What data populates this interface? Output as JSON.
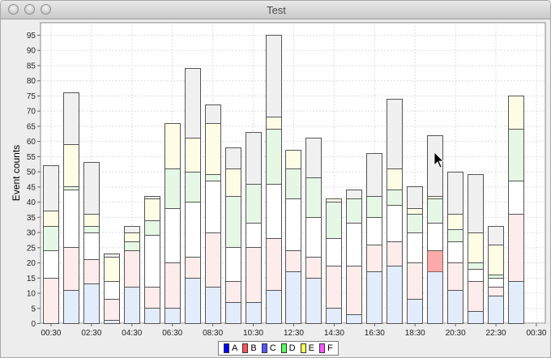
{
  "window": {
    "title": "Test"
  },
  "chart_data": {
    "type": "bar",
    "stacked": true,
    "title": "",
    "xlabel": "",
    "ylabel": "Event counts",
    "ylim": [
      0,
      99
    ],
    "yticks": [
      0,
      5,
      10,
      15,
      20,
      25,
      30,
      35,
      40,
      45,
      50,
      55,
      60,
      65,
      70,
      75,
      80,
      85,
      90,
      95
    ],
    "xlim": [
      0,
      24
    ],
    "xticks": [
      {
        "label": "00:30",
        "x": 0.5
      },
      {
        "label": "02:30",
        "x": 2.5
      },
      {
        "label": "04:30",
        "x": 4.5
      },
      {
        "label": "06:30",
        "x": 6.5
      },
      {
        "label": "08:30",
        "x": 8.5
      },
      {
        "label": "10:30",
        "x": 10.5
      },
      {
        "label": "12:30",
        "x": 12.5
      },
      {
        "label": "14:30",
        "x": 14.5
      },
      {
        "label": "16:30",
        "x": 16.5
      },
      {
        "label": "18:30",
        "x": 18.5
      },
      {
        "label": "20:30",
        "x": 20.5
      },
      {
        "label": "22:30",
        "x": 22.5
      },
      {
        "label": "00:30",
        "x": 24.5
      }
    ],
    "grid": true,
    "legend_position": "bottom-center",
    "x": [
      0.5,
      1.5,
      2.5,
      3.5,
      4.5,
      5.5,
      6.5,
      7.5,
      8.5,
      9.5,
      10.5,
      11.5,
      12.5,
      13.5,
      14.5,
      15.5,
      16.5,
      17.5,
      18.5,
      19.5,
      20.5,
      21.5,
      22.5,
      23.5
    ],
    "series": [
      {
        "name": "A",
        "color": "#0000ff",
        "fill": "#e2ecfb",
        "values": [
          0,
          11,
          13,
          1,
          12,
          5,
          5,
          15,
          12,
          7,
          7,
          11,
          17,
          15,
          5,
          3,
          17,
          19,
          8,
          17,
          11,
          4,
          9,
          14
        ]
      },
      {
        "name": "B",
        "color": "#ff5555",
        "fill": "#fcecec",
        "values": [
          15,
          14,
          8,
          7,
          12,
          7,
          15,
          7,
          18,
          7,
          18,
          17,
          7,
          7,
          14,
          16,
          9,
          8,
          12,
          7,
          9,
          10,
          3,
          22
        ]
      },
      {
        "name": "C",
        "color": "#5555ff",
        "fill": "#ffffff",
        "values": [
          9,
          19,
          9,
          6,
          0,
          17,
          18,
          18,
          17,
          11,
          8,
          18,
          17,
          13,
          9,
          14,
          9,
          12,
          10,
          9,
          7,
          4,
          3,
          11
        ]
      },
      {
        "name": "D",
        "color": "#55ff55",
        "fill": "#e6f7e6",
        "values": [
          8,
          1,
          2,
          0,
          3,
          5,
          13,
          10,
          2,
          17,
          13,
          18,
          10,
          13,
          12,
          8,
          7,
          5,
          6,
          8,
          4,
          2,
          1,
          17
        ]
      },
      {
        "name": "E",
        "color": "#ffff55",
        "fill": "#fdfde6",
        "values": [
          5,
          14,
          4,
          8,
          3,
          7,
          15,
          11,
          17,
          9,
          0,
          4,
          6,
          0,
          1,
          0,
          0,
          7,
          2,
          1,
          5,
          10,
          10,
          11
        ]
      },
      {
        "name": "F",
        "color": "#ff55ff",
        "fill": "#f0f0f0",
        "values": [
          15,
          17,
          17,
          1,
          2,
          1,
          0,
          23,
          6,
          7,
          17,
          27,
          0,
          13,
          0,
          3,
          14,
          23,
          7,
          20,
          14,
          19,
          6,
          0
        ]
      }
    ],
    "highlighted": {
      "series": "B",
      "bar_index": 19,
      "fill": "#ffaaaa"
    }
  },
  "legend": {
    "items": [
      {
        "label": "A",
        "color": "#0000ff"
      },
      {
        "label": "B",
        "color": "#ff5555"
      },
      {
        "label": "C",
        "color": "#5555ff"
      },
      {
        "label": "D",
        "color": "#55ff55"
      },
      {
        "label": "E",
        "color": "#ffff55"
      },
      {
        "label": "F",
        "color": "#ff55ff"
      }
    ]
  }
}
